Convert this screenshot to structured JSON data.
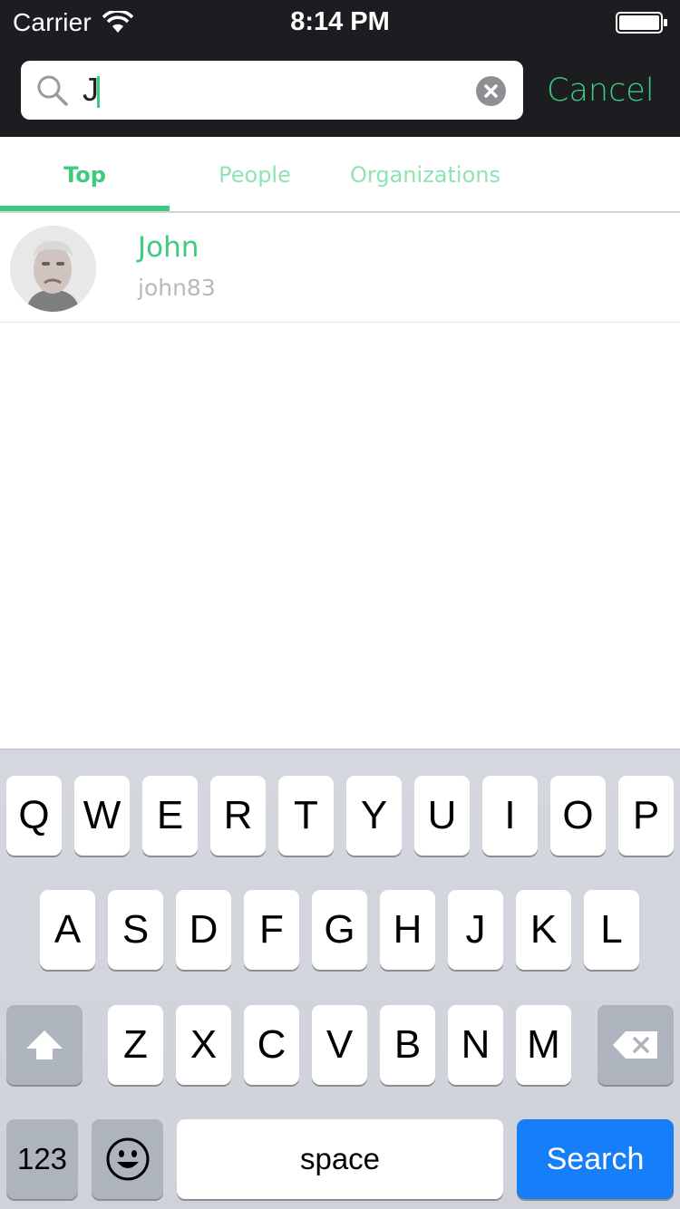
{
  "status_bar": {
    "carrier": "Carrier",
    "time": "8:14 PM"
  },
  "search": {
    "query": "J",
    "cancel_label": "Cancel"
  },
  "tabs": [
    {
      "label": "Top",
      "active": true
    },
    {
      "label": "People",
      "active": false
    },
    {
      "label": "Organizations",
      "active": false
    }
  ],
  "results": [
    {
      "name": "John",
      "username": "john83"
    }
  ],
  "keyboard": {
    "row1": [
      "Q",
      "W",
      "E",
      "R",
      "T",
      "Y",
      "U",
      "I",
      "O",
      "P"
    ],
    "row2": [
      "A",
      "S",
      "D",
      "F",
      "G",
      "H",
      "J",
      "K",
      "L"
    ],
    "row3": [
      "Z",
      "X",
      "C",
      "V",
      "B",
      "N",
      "M"
    ],
    "numbers_label": "123",
    "space_label": "space",
    "search_label": "Search"
  },
  "colors": {
    "accent": "#3ecb7f",
    "header_bg": "#1b1d21",
    "search_key": "#167ef9"
  },
  "icons": [
    "wifi-icon",
    "battery-icon",
    "search-icon",
    "clear-icon",
    "shift-icon",
    "backspace-icon",
    "emoji-icon"
  ]
}
